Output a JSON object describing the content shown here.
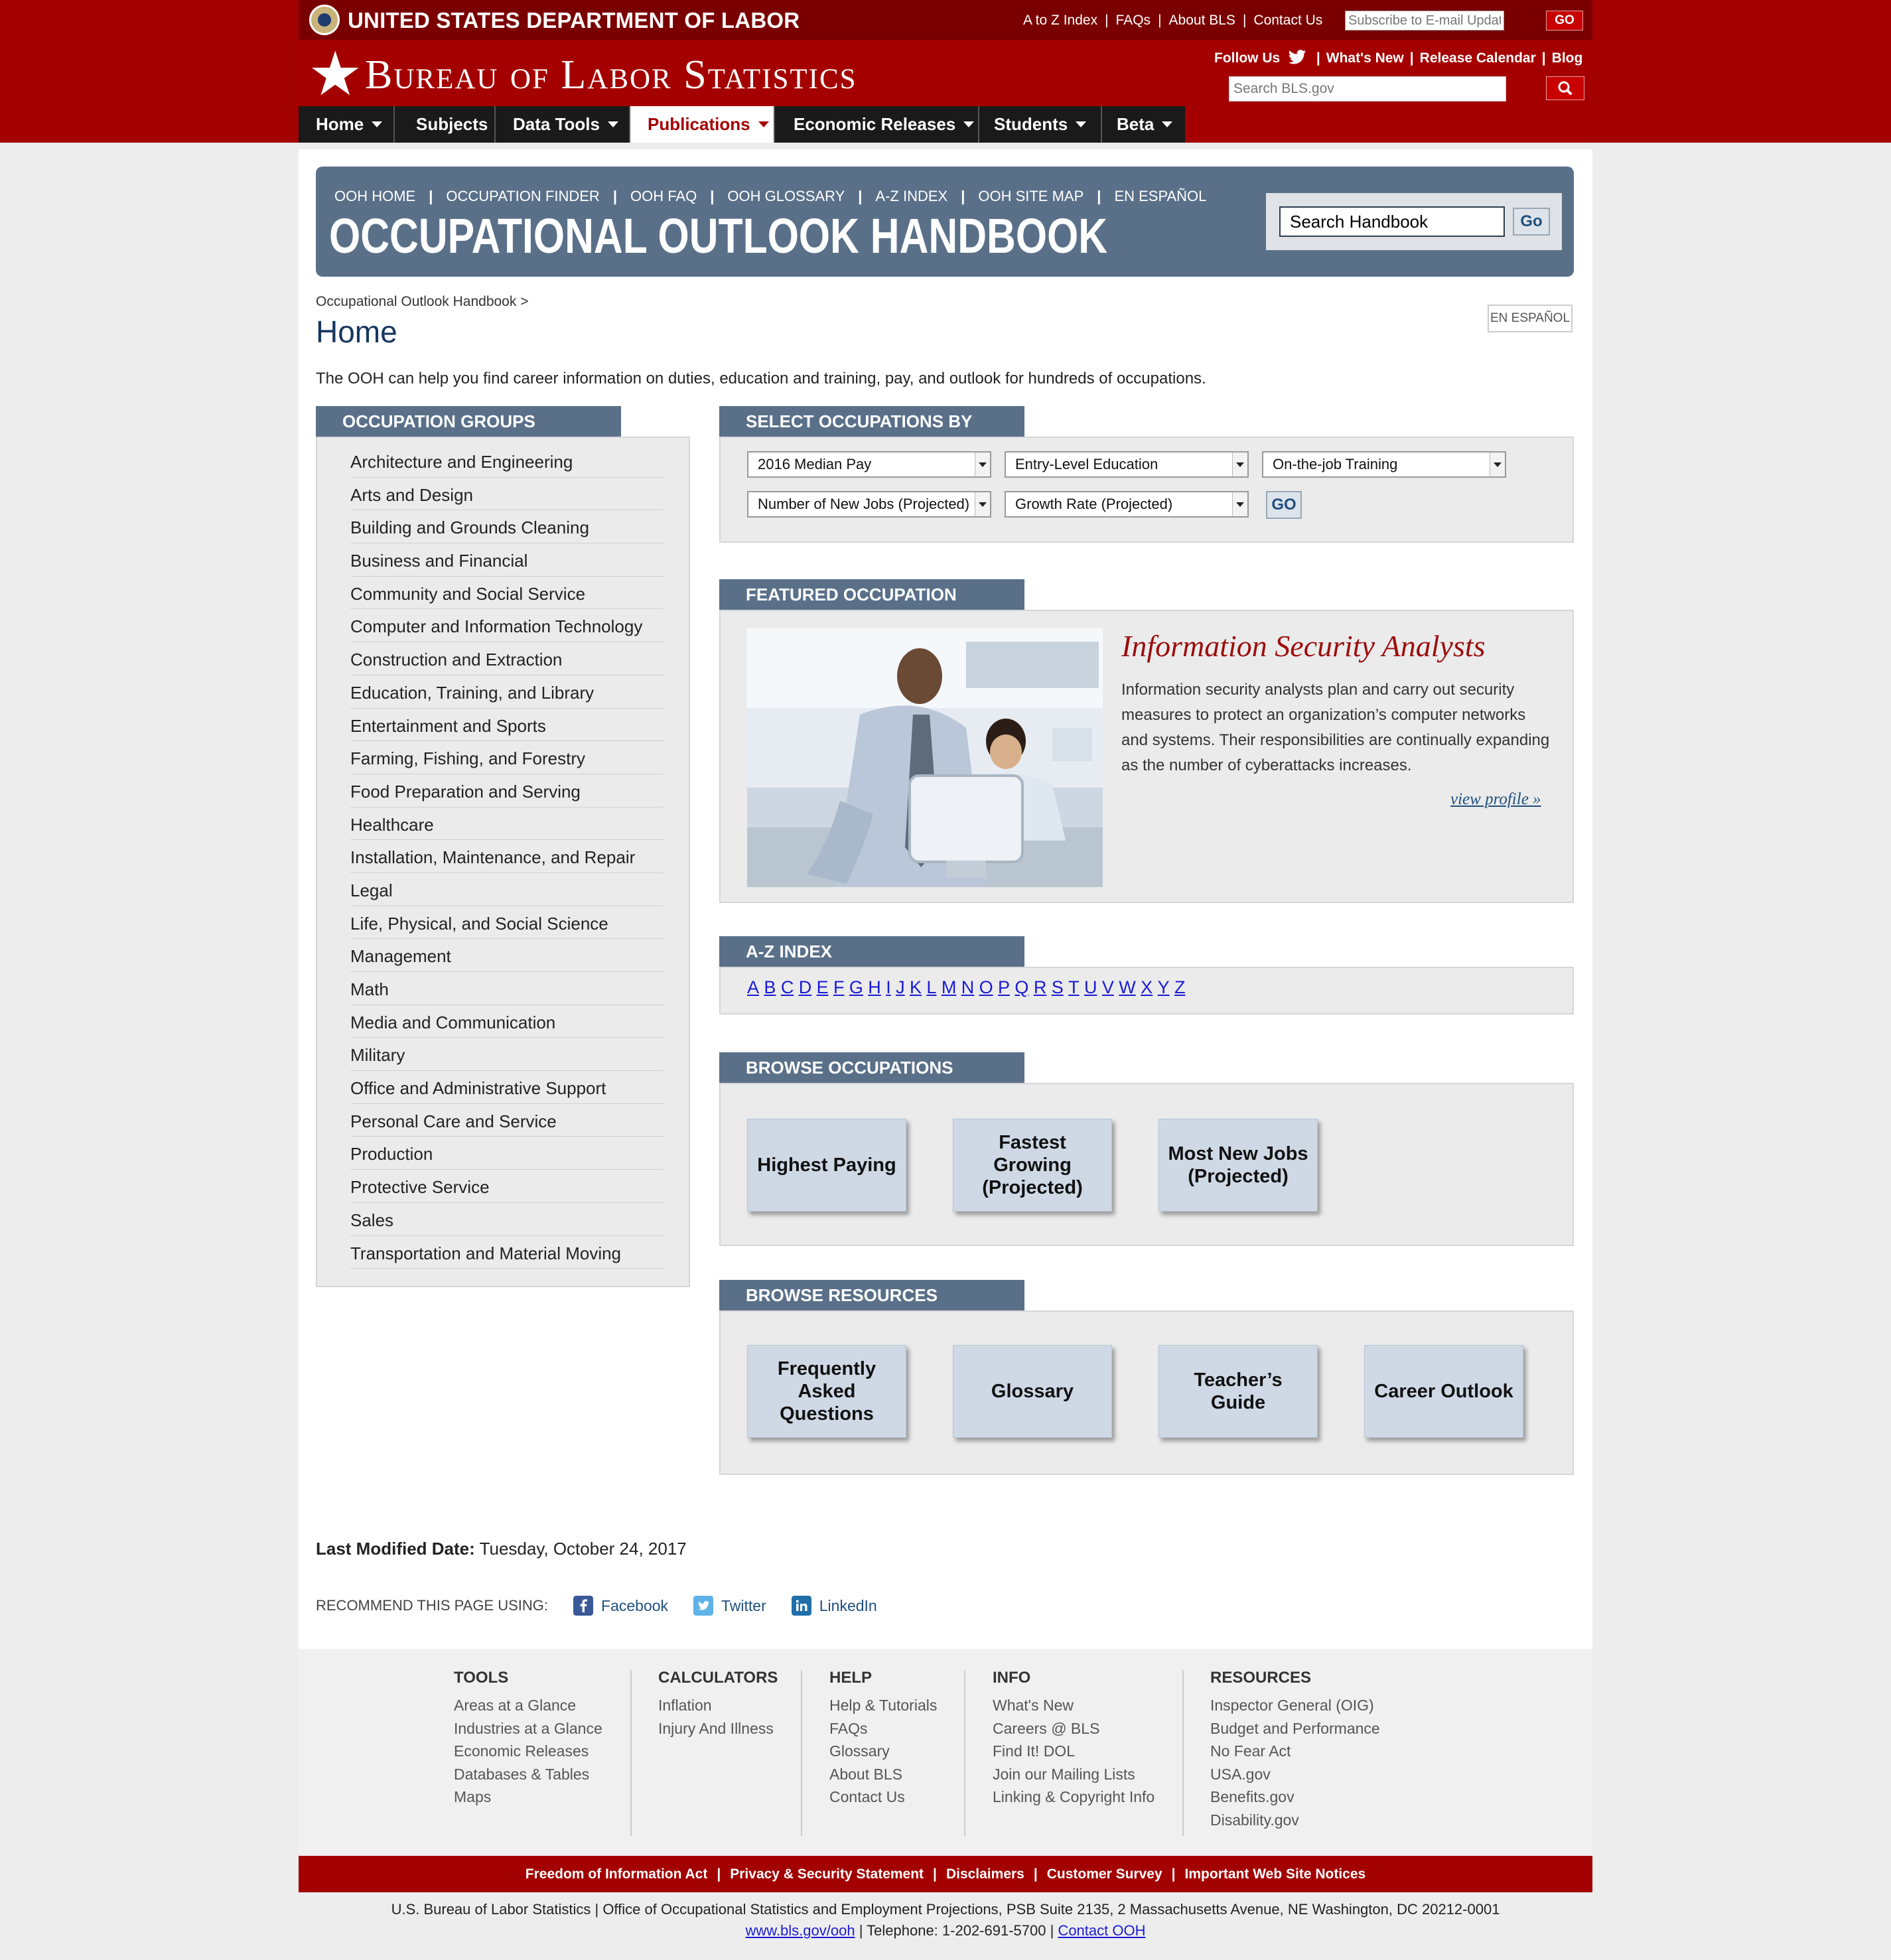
{
  "dol": {
    "title": "UNITED STATES DEPARTMENT OF LABOR",
    "links": [
      "A to Z Index",
      "FAQs",
      "About BLS",
      "Contact Us"
    ],
    "subscribe_placeholder": "Subscribe to E-mail Updates",
    "subscribe_go": "GO"
  },
  "bls": {
    "title": "Bureau of Labor Statistics",
    "follow": "Follow Us",
    "links": [
      "What's New",
      "Release Calendar",
      "Blog"
    ],
    "search_placeholder": "Search BLS.gov"
  },
  "nav": [
    {
      "label": "Home"
    },
    {
      "label": "Subjects"
    },
    {
      "label": "Data Tools"
    },
    {
      "label": "Publications"
    },
    {
      "label": "Economic Releases"
    },
    {
      "label": "Students"
    },
    {
      "label": "Beta"
    }
  ],
  "ooh": {
    "links": [
      "OOH HOME",
      "OCCUPATION FINDER",
      "OOH FAQ",
      "OOH GLOSSARY",
      "A-Z INDEX",
      "OOH SITE MAP",
      "EN ESPAÑOL"
    ],
    "title": "OCCUPATIONAL OUTLOOK HANDBOOK",
    "search_value": "Search Handbook",
    "search_go": "Go"
  },
  "page": {
    "breadcrumb": "Occupational Outlook Handbook >",
    "title": "Home",
    "espanol": "EN ESPAÑOL",
    "intro": "The OOH can help you find career information on duties, education and training, pay, and outlook for hundreds of occupations."
  },
  "occupation_groups": {
    "heading": "OCCUPATION GROUPS",
    "items": [
      "Architecture and Engineering",
      "Arts and Design",
      "Building and Grounds Cleaning",
      "Business and Financial",
      "Community and Social Service",
      "Computer and Information Technology",
      "Construction and Extraction",
      "Education, Training, and Library",
      "Entertainment and Sports",
      "Farming, Fishing, and Forestry",
      "Food Preparation and Serving",
      "Healthcare",
      "Installation, Maintenance, and Repair",
      "Legal",
      "Life, Physical, and Social Science",
      "Management",
      "Math",
      "Media and Communication",
      "Military",
      "Office and Administrative Support",
      "Personal Care and Service",
      "Production",
      "Protective Service",
      "Sales",
      "Transportation and Material Moving"
    ]
  },
  "select_by": {
    "heading": "SELECT OCCUPATIONS BY",
    "selects": [
      "2016 Median Pay",
      "Entry-Level Education",
      "On-the-job Training",
      "Number of New Jobs (Projected)",
      "Growth Rate (Projected)"
    ],
    "go": "GO"
  },
  "featured": {
    "heading": "FEATURED OCCUPATION",
    "name": "Information Security Analysts",
    "description": "Information security analysts plan and carry out security measures to protect an organization’s computer networks and systems. Their responsibilities are continually expanding as the number of cyberattacks increases.",
    "link": "view profile »"
  },
  "az": {
    "heading": "A-Z INDEX",
    "letters": [
      "A",
      "B",
      "C",
      "D",
      "E",
      "F",
      "G",
      "H",
      "I",
      "J",
      "K",
      "L",
      "M",
      "N",
      "O",
      "P",
      "Q",
      "R",
      "S",
      "T",
      "U",
      "V",
      "W",
      "X",
      "Y",
      "Z"
    ]
  },
  "browse_occupations": {
    "heading": "BROWSE OCCUPATIONS",
    "tiles": [
      "Highest Paying",
      "Fastest Growing (Projected)",
      "Most New Jobs (Projected)"
    ]
  },
  "browse_resources": {
    "heading": "BROWSE RESOURCES",
    "tiles": [
      "Frequently Asked Questions",
      "Glossary",
      "Teacher’s Guide",
      "Career Outlook"
    ]
  },
  "last_modified": {
    "label": "Last Modified Date:",
    "value": "Tuesday, October 24, 2017"
  },
  "recommend": {
    "label": "RECOMMEND THIS PAGE USING:",
    "networks": [
      "Facebook",
      "Twitter",
      "LinkedIn"
    ]
  },
  "footer": {
    "columns": [
      {
        "title": "TOOLS",
        "links": [
          "Areas at a Glance",
          "Industries at a Glance",
          "Economic Releases",
          "Databases & Tables",
          "Maps"
        ]
      },
      {
        "title": "CALCULATORS",
        "links": [
          "Inflation",
          "Injury And Illness"
        ]
      },
      {
        "title": "HELP",
        "links": [
          "Help & Tutorials",
          "FAQs",
          "Glossary",
          "About BLS",
          "Contact Us"
        ]
      },
      {
        "title": "INFO",
        "links": [
          "What's New",
          "Careers @ BLS",
          "Find It! DOL",
          "Join our Mailing Lists",
          "Linking & Copyright Info"
        ]
      },
      {
        "title": "RESOURCES",
        "links": [
          "Inspector General (OIG)",
          "Budget and Performance",
          "No Fear Act",
          "USA.gov",
          "Benefits.gov",
          "Disability.gov"
        ]
      }
    ],
    "legal_links": [
      "Freedom of Information Act",
      "Privacy & Security Statement",
      "Disclaimers",
      "Customer Survey",
      "Important Web Site Notices"
    ],
    "address": "U.S. Bureau of Labor Statistics | Office of Occupational Statistics and Employment Projections, PSB Suite 2135, 2 Massachusetts Avenue, NE Washington, DC 20212-0001",
    "site": "www.bls.gov/ooh",
    "phone": "| Telephone: 1-202-691-5700 |",
    "contact": "Contact OOH"
  },
  "colors": {
    "header_red": "#a50000",
    "dol_bar": "#7a0000",
    "banner_slate": "#5a7089",
    "tile_blue": "#cfd9e6",
    "featured_red": "#9c0d0d",
    "link_blue": "#1a1ad6"
  }
}
